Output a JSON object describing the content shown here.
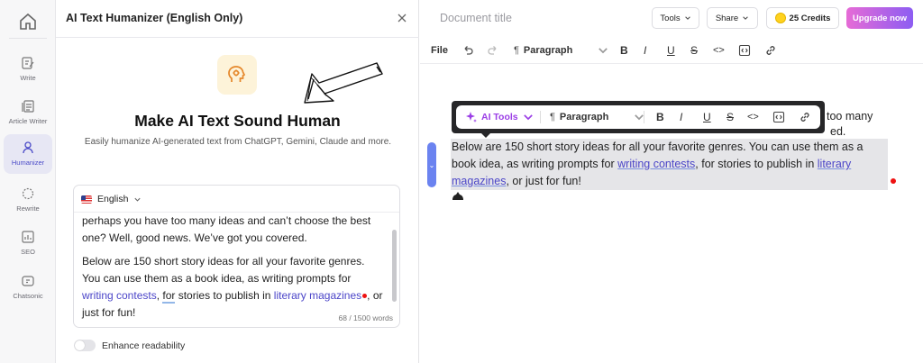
{
  "rail": {
    "items": [
      {
        "label": "Write",
        "icon": "write-icon"
      },
      {
        "label": "Article Writer",
        "icon": "article-icon"
      },
      {
        "label": "Humanizer",
        "icon": "person-icon",
        "active": true
      },
      {
        "label": "Rewrite",
        "icon": "rewrite-icon"
      },
      {
        "label": "SEO",
        "icon": "seo-icon"
      },
      {
        "label": "Chatsonic",
        "icon": "chatsonic-icon"
      }
    ]
  },
  "panel": {
    "title": "AI Text Humanizer (English Only)",
    "hero_title": "Make AI Text Sound Human",
    "hero_subtitle": "Easily humanize AI-generated text from ChatGPT, Gemini, Claude and more.",
    "language": "English",
    "text_p1": "perhaps you have too many ideas and can’t choose the best one? Well, good news. We’ve got you covered.",
    "text_p2_a": "Below are 150 short story ideas for all your favorite genres. You can use them as a book idea, as writing prompts for ",
    "text_link1": "writing contests",
    "text_p2_b": ", ",
    "text_for": "for",
    "text_p2_c": " stories to publish in ",
    "text_link2": "literary magazines",
    "text_p2_d": ", or just for fun!",
    "word_count": "68 / 1500 words",
    "enhance_label": "Enhance readability"
  },
  "editor": {
    "doc_title_placeholder": "Document title",
    "tools_label": "Tools",
    "share_label": "Share",
    "credits_label": "25 Credits",
    "upgrade_label": "Upgrade now",
    "toolbar": {
      "file_label": "File",
      "paragraph_label": "Paragraph"
    },
    "float": {
      "ai_tools_label": "AI Tools",
      "paragraph_label": "Paragraph"
    },
    "behind_line1": "too many",
    "behind_line2": "ed.",
    "para_a": "Below are 150 short story ideas for all your favorite genres. You can use them as a book idea, as writing prompts for ",
    "link1": "writing contests",
    "para_b": ", for stories to publish in ",
    "link2": "literary magazines",
    "para_c": ", or just for fun!"
  }
}
